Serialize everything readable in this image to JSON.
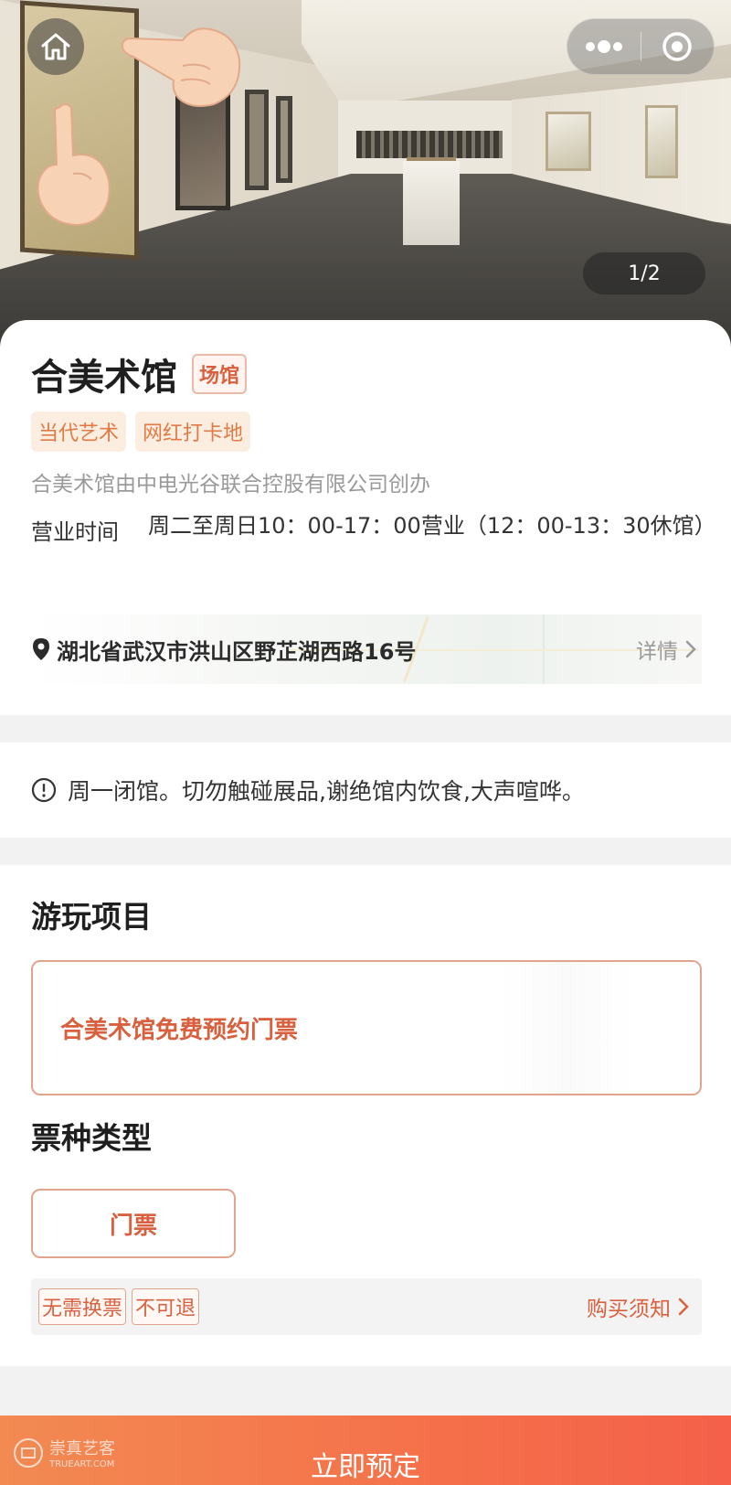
{
  "hero": {
    "counter": "1/2"
  },
  "venue": {
    "name": "合美术馆",
    "badge": "场馆",
    "tags": [
      "当代艺术",
      "网红打卡地"
    ],
    "description": "合美术馆由中电光谷联合控股有限公司创办",
    "hours_label": "营业时间",
    "hours": "周二至周日10：00-17：00营业（12：00-13：30休馆）",
    "address": "湖北省武汉市洪山区野芷湖西路16号",
    "detail_label": "详情"
  },
  "notice": {
    "text": "周一闭馆。切勿触碰展品,谢绝馆内饮食,大声喧哗。"
  },
  "play": {
    "title": "游玩项目",
    "item_label": "合美术馆免费预约门票",
    "ticket_type_title": "票种类型",
    "ticket_type": "门票",
    "rule_tags": [
      "无需换票",
      "不可退"
    ],
    "purchase_label": "购买须知"
  },
  "footer": {
    "book_label": "立即预定",
    "watermark": "崇真艺客",
    "watermark_sub": "TRUEART.COM"
  },
  "colors": {
    "accent": "#d9603e",
    "tag_bg": "#fbeee0",
    "button_gradient_start": "#f28a52",
    "button_gradient_end": "#f4604a"
  },
  "icons": {
    "home": "home-icon",
    "more": "more-dots-icon",
    "close": "target-circle-icon",
    "pin": "location-pin-icon",
    "notice": "exclamation-circle-icon",
    "chevron": "chevron-right-icon"
  }
}
